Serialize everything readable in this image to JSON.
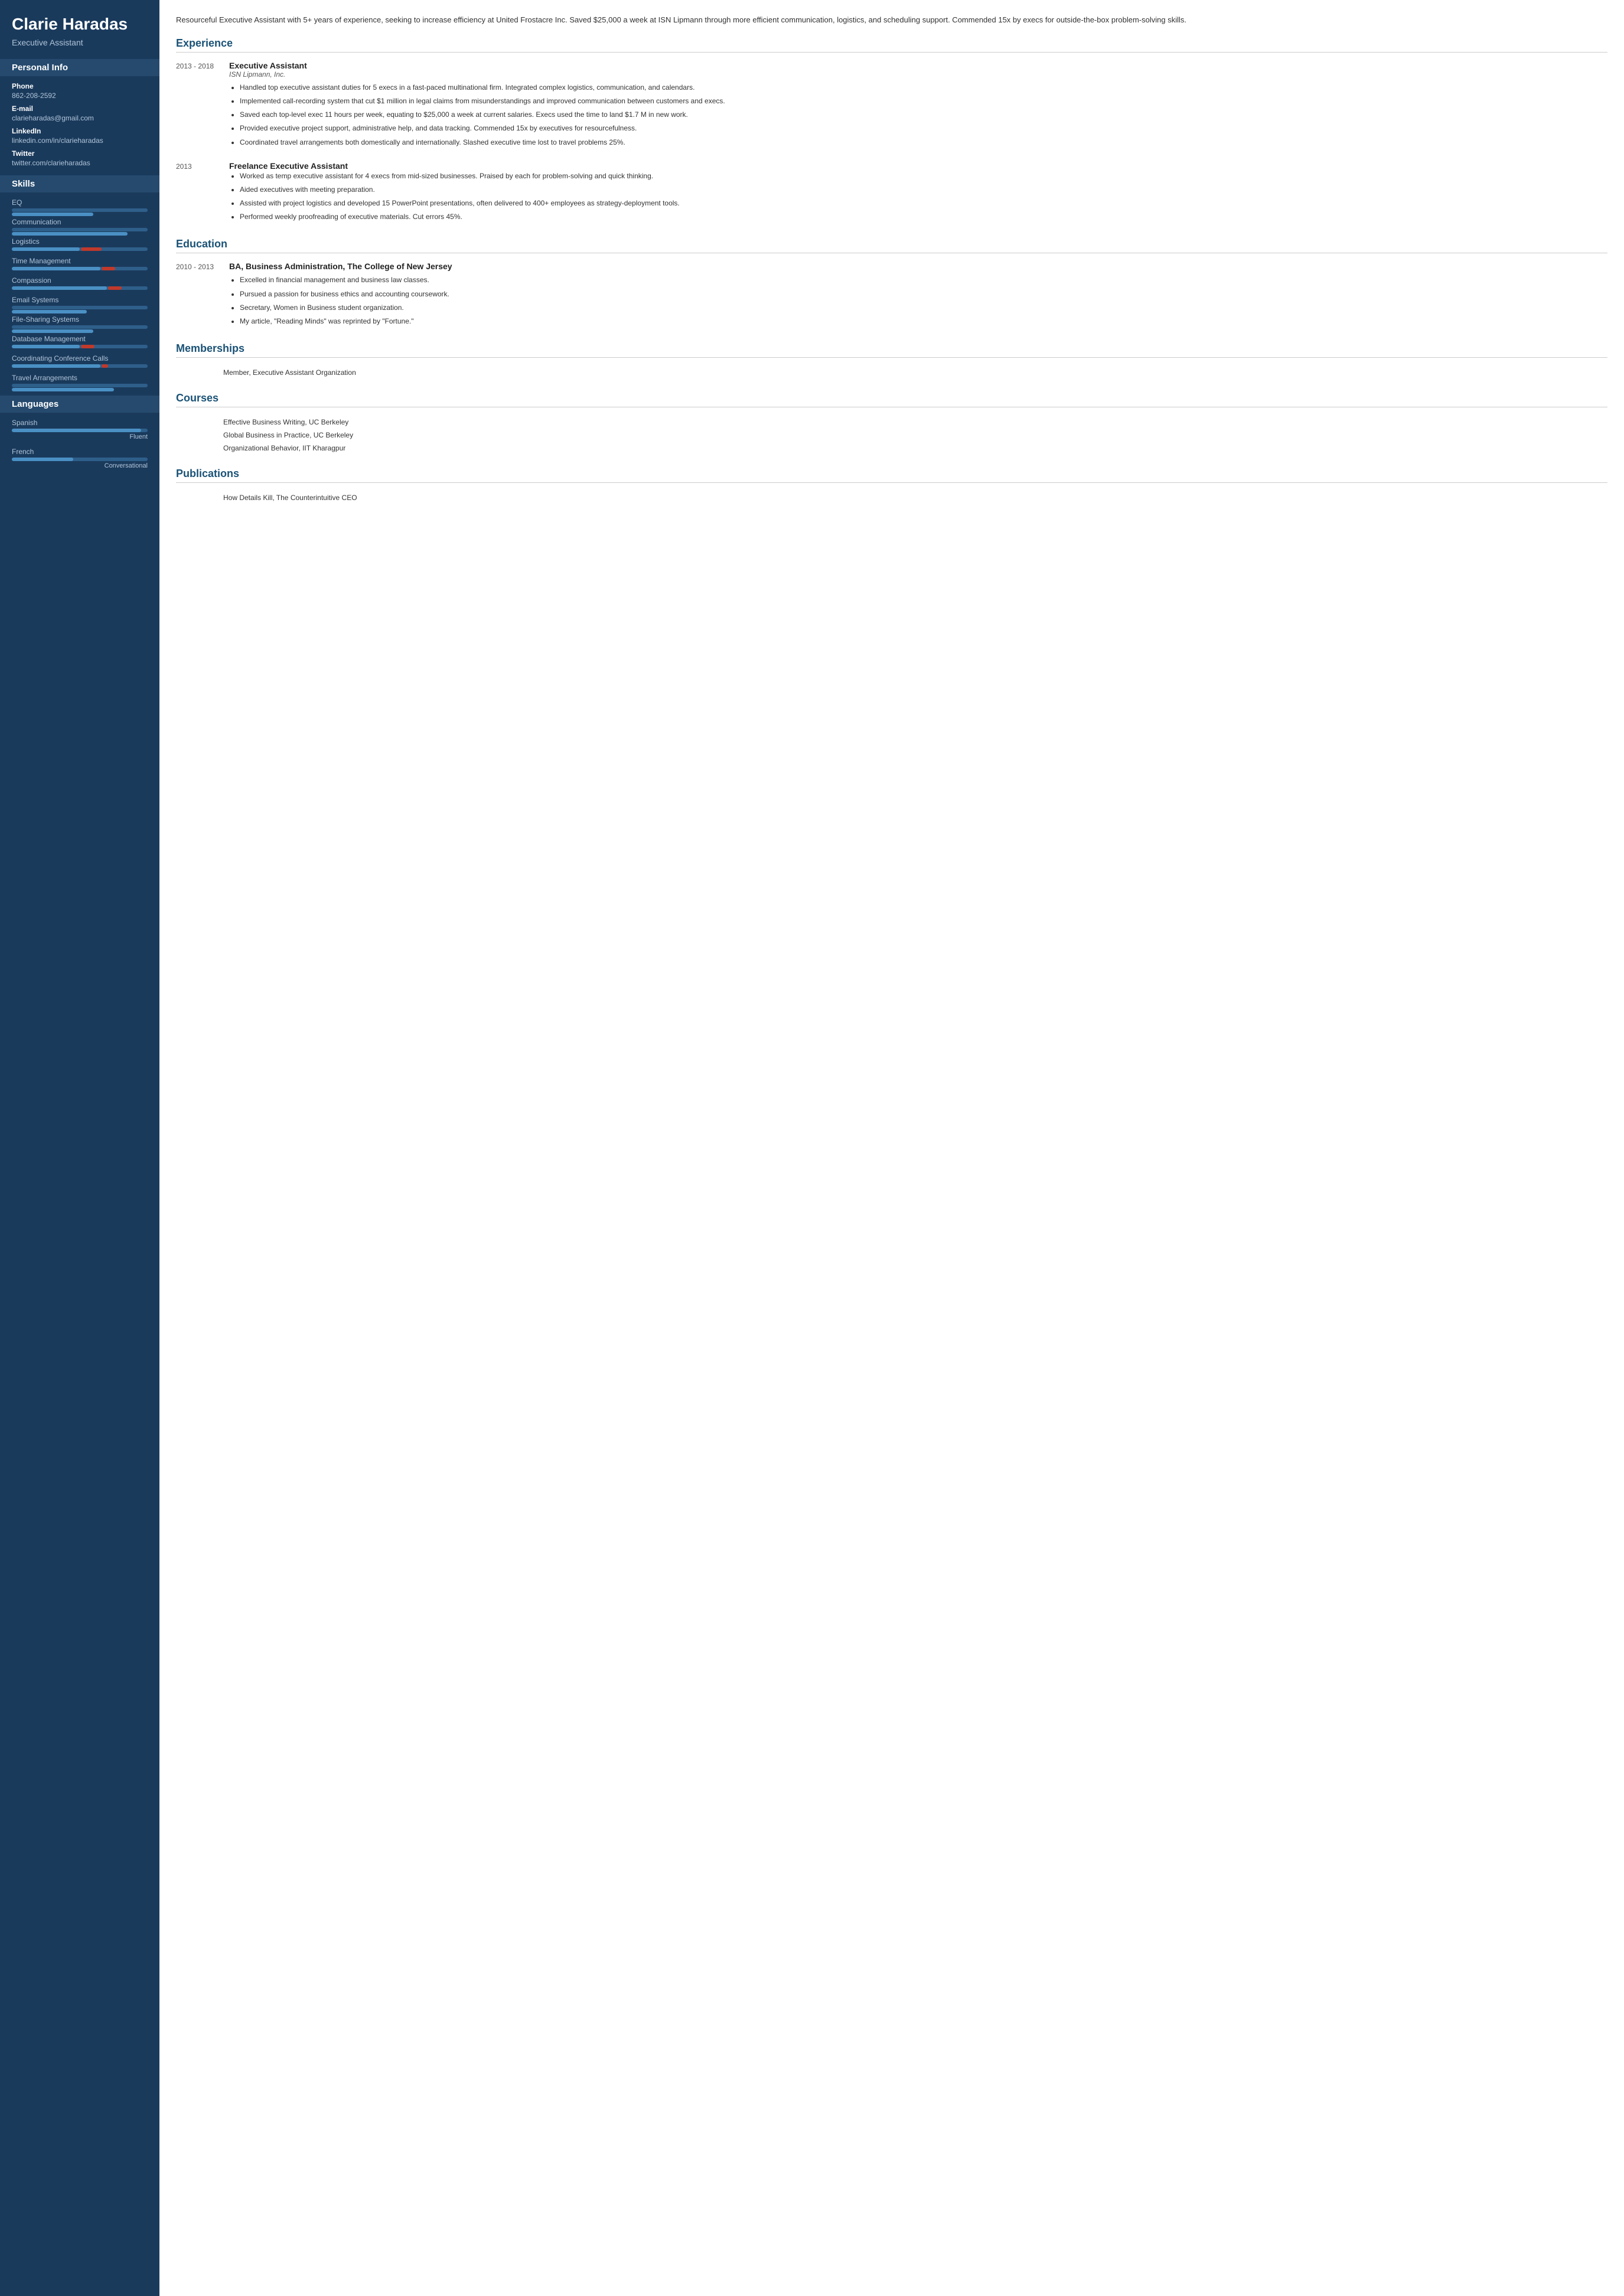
{
  "sidebar": {
    "name": "Clarie Haradas",
    "title": "Executive Assistant",
    "personal_info": {
      "section_title": "Personal Info",
      "phone_label": "Phone",
      "phone_value": "862-208-2592",
      "email_label": "E-mail",
      "email_value": "clarieharadas@gmail.com",
      "linkedin_label": "LinkedIn",
      "linkedin_value": "linkedin.com/in/clarieharadas",
      "twitter_label": "Twitter",
      "twitter_value": "twitter.com/clarieharadas"
    },
    "skills": {
      "section_title": "Skills",
      "items": [
        {
          "name": "EQ",
          "fill": 60,
          "accent": 0
        },
        {
          "name": "Communication",
          "fill": 85,
          "accent": 0
        },
        {
          "name": "Logistics",
          "fill": 50,
          "accent": 15
        },
        {
          "name": "Time Management",
          "fill": 65,
          "accent": 10
        },
        {
          "name": "Compassion",
          "fill": 70,
          "accent": 10
        },
        {
          "name": "Email Systems",
          "fill": 55,
          "accent": 0
        },
        {
          "name": "File-Sharing Systems",
          "fill": 60,
          "accent": 0
        },
        {
          "name": "Database Management",
          "fill": 50,
          "accent": 10
        },
        {
          "name": "Coordinating Conference Calls",
          "fill": 65,
          "accent": 5
        },
        {
          "name": "Travel Arrangements",
          "fill": 75,
          "accent": 0
        }
      ]
    },
    "languages": {
      "section_title": "Languages",
      "items": [
        {
          "name": "Spanish",
          "fill": 95,
          "level": "Fluent"
        },
        {
          "name": "French",
          "fill": 45,
          "level": "Conversational"
        }
      ]
    }
  },
  "main": {
    "summary": "Resourceful Executive Assistant with 5+ years of experience, seeking to increase efficiency at United Frostacre Inc. Saved $25,000 a week at ISN Lipmann through more efficient communication, logistics, and scheduling support. Commended 15x by execs for outside-the-box problem-solving skills.",
    "experience": {
      "section_title": "Experience",
      "jobs": [
        {
          "date": "2013 - 2018",
          "title": "Executive Assistant",
          "company": "ISN Lipmann, Inc.",
          "bullets": [
            "Handled top executive assistant duties for 5 execs in a fast-paced multinational firm. Integrated complex logistics, communication, and calendars.",
            "Implemented call-recording system that cut $1 million in legal claims from misunderstandings and improved communication between customers and execs.",
            "Saved each top-level exec 11 hours per week, equating to $25,000 a week at current salaries. Execs used the time to land $1.7 M in new work.",
            "Provided executive project support, administrative help, and data tracking. Commended 15x by executives for resourcefulness.",
            "Coordinated travel arrangements both domestically and internationally. Slashed executive time lost to travel problems 25%."
          ]
        },
        {
          "date": "2013",
          "title": "Freelance Executive Assistant",
          "company": "",
          "bullets": [
            "Worked as temp executive assistant for 4 execs from mid-sized businesses. Praised by each for problem-solving and quick thinking.",
            "Aided executives with meeting preparation.",
            "Assisted with project logistics and developed 15 PowerPoint presentations, often delivered to 400+ employees as strategy-deployment tools.",
            "Performed weekly proofreading of executive materials. Cut errors 45%."
          ]
        }
      ]
    },
    "education": {
      "section_title": "Education",
      "items": [
        {
          "date": "2010 - 2013",
          "degree": "BA, Business Administration, The College of New Jersey",
          "bullets": [
            "Excelled in financial management and business law classes.",
            "Pursued a passion for business ethics and accounting coursework.",
            "Secretary, Women in Business student organization.",
            "My article, \"Reading Minds\" was reprinted by \"Fortune.\""
          ]
        }
      ]
    },
    "memberships": {
      "section_title": "Memberships",
      "items": [
        "Member, Executive Assistant Organization"
      ]
    },
    "courses": {
      "section_title": "Courses",
      "items": [
        "Effective Business Writing, UC Berkeley",
        "Global Business in Practice, UC Berkeley",
        "Organizational Behavior, IIT Kharagpur"
      ]
    },
    "publications": {
      "section_title": "Publications",
      "items": [
        "How Details Kill, The Counterintuitive CEO"
      ]
    }
  }
}
